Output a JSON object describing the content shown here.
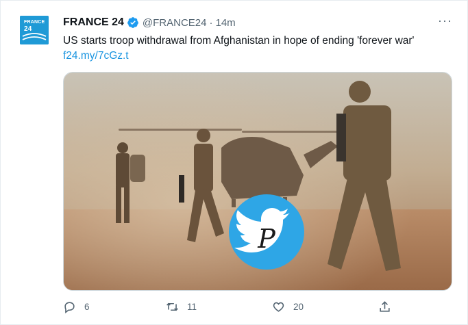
{
  "tweet": {
    "author_name": "FRANCE 24",
    "handle": "@FRANCE24",
    "separator": "·",
    "time": "14m",
    "text": "US starts troop withdrawal from Afghanistan in hope of ending 'forever war'",
    "link": "f24.my/7cGz.t",
    "more_label": "···"
  },
  "avatar": {
    "brand_line1": "FRANCE",
    "brand_line2": "24",
    "color": "#1f9ad6"
  },
  "media": {
    "watermark_letter": "P"
  },
  "actions": {
    "reply_count": "6",
    "retweet_count": "11",
    "like_count": "20"
  },
  "icons": {
    "verified": "verified-badge-icon",
    "reply": "reply-icon",
    "retweet": "retweet-icon",
    "like": "heart-icon",
    "share": "share-icon",
    "more": "more-icon"
  },
  "colors": {
    "accent": "#1d9bf0",
    "link": "#1b95e0",
    "muted": "#536471"
  }
}
